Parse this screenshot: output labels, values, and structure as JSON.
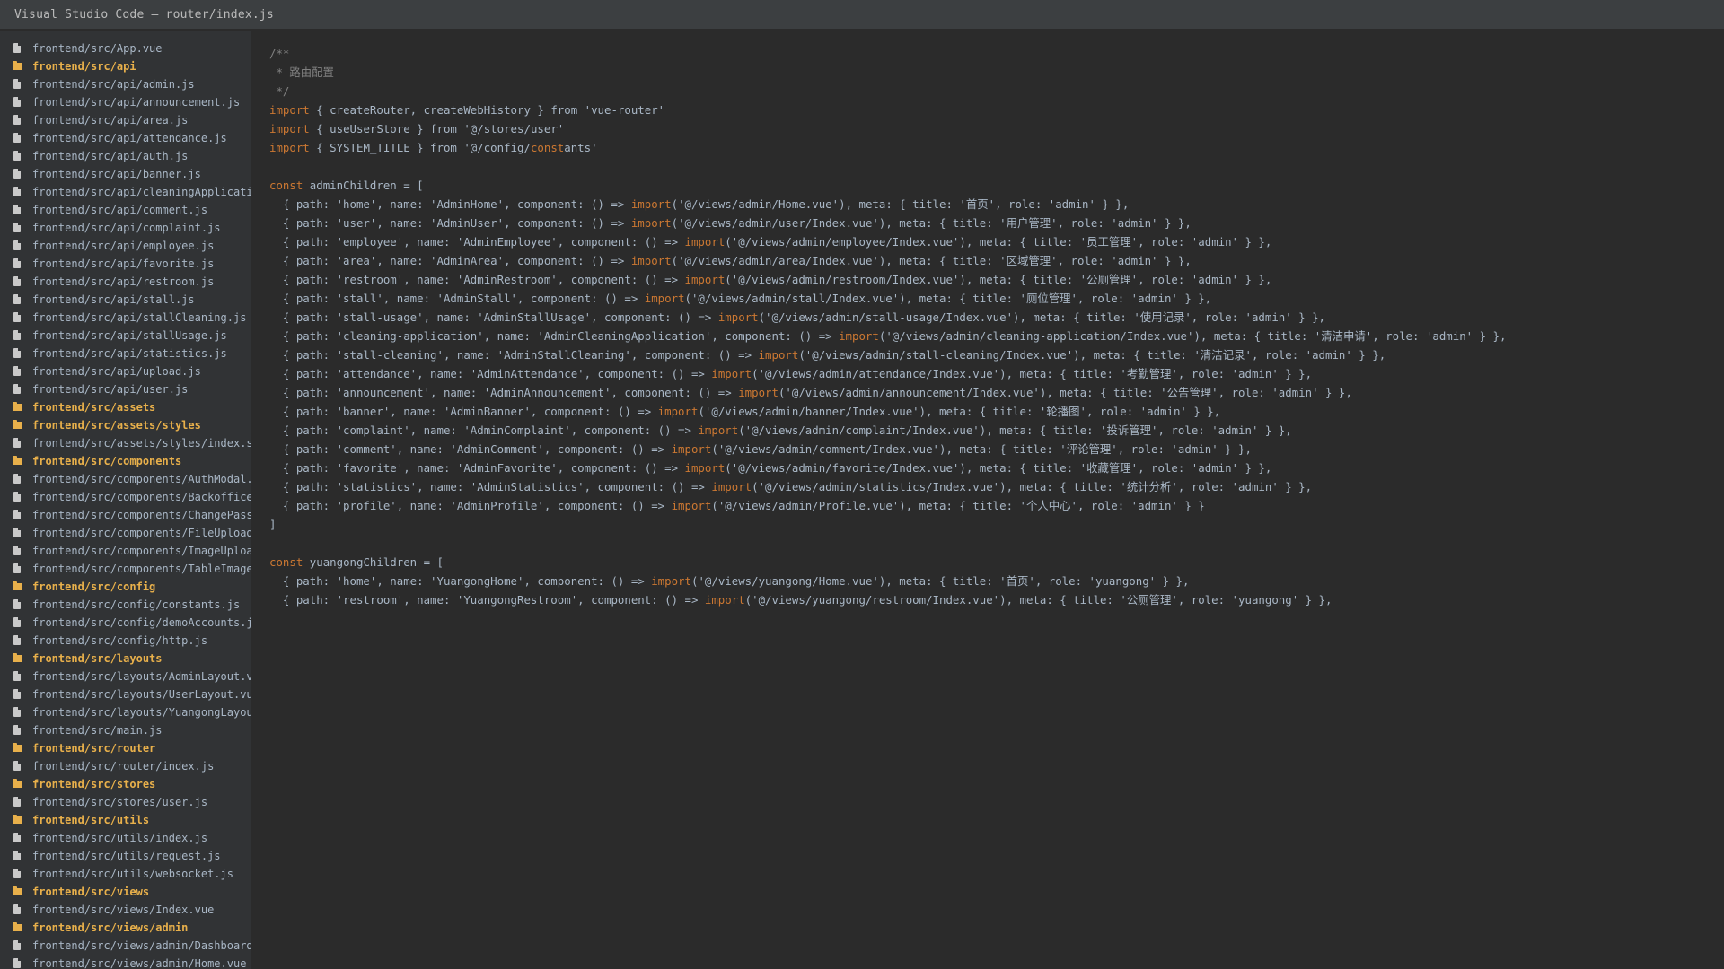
{
  "window": {
    "title": "Visual Studio Code — router/index.js"
  },
  "explorer": {
    "items": [
      {
        "type": "file",
        "label": "frontend/src/App.vue"
      },
      {
        "type": "folder",
        "label": "frontend/src/api"
      },
      {
        "type": "file",
        "label": "frontend/src/api/admin.js"
      },
      {
        "type": "file",
        "label": "frontend/src/api/announcement.js"
      },
      {
        "type": "file",
        "label": "frontend/src/api/area.js"
      },
      {
        "type": "file",
        "label": "frontend/src/api/attendance.js"
      },
      {
        "type": "file",
        "label": "frontend/src/api/auth.js"
      },
      {
        "type": "file",
        "label": "frontend/src/api/banner.js"
      },
      {
        "type": "file",
        "label": "frontend/src/api/cleaningApplicati"
      },
      {
        "type": "file",
        "label": "frontend/src/api/comment.js"
      },
      {
        "type": "file",
        "label": "frontend/src/api/complaint.js"
      },
      {
        "type": "file",
        "label": "frontend/src/api/employee.js"
      },
      {
        "type": "file",
        "label": "frontend/src/api/favorite.js"
      },
      {
        "type": "file",
        "label": "frontend/src/api/restroom.js"
      },
      {
        "type": "file",
        "label": "frontend/src/api/stall.js"
      },
      {
        "type": "file",
        "label": "frontend/src/api/stallCleaning.js"
      },
      {
        "type": "file",
        "label": "frontend/src/api/stallUsage.js"
      },
      {
        "type": "file",
        "label": "frontend/src/api/statistics.js"
      },
      {
        "type": "file",
        "label": "frontend/src/api/upload.js"
      },
      {
        "type": "file",
        "label": "frontend/src/api/user.js"
      },
      {
        "type": "folder",
        "label": "frontend/src/assets"
      },
      {
        "type": "folder",
        "label": "frontend/src/assets/styles"
      },
      {
        "type": "file",
        "label": "frontend/src/assets/styles/index.s"
      },
      {
        "type": "folder",
        "label": "frontend/src/components"
      },
      {
        "type": "file",
        "label": "frontend/src/components/AuthModal."
      },
      {
        "type": "file",
        "label": "frontend/src/components/Backoffice"
      },
      {
        "type": "file",
        "label": "frontend/src/components/ChangePass"
      },
      {
        "type": "file",
        "label": "frontend/src/components/FileUpload"
      },
      {
        "type": "file",
        "label": "frontend/src/components/ImageUploa"
      },
      {
        "type": "file",
        "label": "frontend/src/components/TableImage"
      },
      {
        "type": "folder",
        "label": "frontend/src/config"
      },
      {
        "type": "file",
        "label": "frontend/src/config/constants.js"
      },
      {
        "type": "file",
        "label": "frontend/src/config/demoAccounts.j"
      },
      {
        "type": "file",
        "label": "frontend/src/config/http.js"
      },
      {
        "type": "folder",
        "label": "frontend/src/layouts"
      },
      {
        "type": "file",
        "label": "frontend/src/layouts/AdminLayout.v"
      },
      {
        "type": "file",
        "label": "frontend/src/layouts/UserLayout.vu"
      },
      {
        "type": "file",
        "label": "frontend/src/layouts/YuangongLayou"
      },
      {
        "type": "file",
        "label": "frontend/src/main.js"
      },
      {
        "type": "folder",
        "label": "frontend/src/router"
      },
      {
        "type": "file",
        "label": "frontend/src/router/index.js"
      },
      {
        "type": "folder",
        "label": "frontend/src/stores"
      },
      {
        "type": "file",
        "label": "frontend/src/stores/user.js"
      },
      {
        "type": "folder",
        "label": "frontend/src/utils"
      },
      {
        "type": "file",
        "label": "frontend/src/utils/index.js"
      },
      {
        "type": "file",
        "label": "frontend/src/utils/request.js"
      },
      {
        "type": "file",
        "label": "frontend/src/utils/websocket.js"
      },
      {
        "type": "folder",
        "label": "frontend/src/views"
      },
      {
        "type": "file",
        "label": "frontend/src/views/Index.vue"
      },
      {
        "type": "folder",
        "label": "frontend/src/views/admin"
      },
      {
        "type": "file",
        "label": "frontend/src/views/admin/Dashboard"
      },
      {
        "type": "file",
        "label": "frontend/src/views/admin/Home.vue"
      }
    ]
  },
  "editor": {
    "lines": [
      [
        {
          "t": "c",
          "s": "/**"
        }
      ],
      [
        {
          "t": "c",
          "s": " * 路由配置"
        }
      ],
      [
        {
          "t": "c",
          "s": " */"
        }
      ],
      [
        {
          "t": "k",
          "s": "import"
        },
        {
          "t": "p",
          "s": " { createRouter, createWebHistory } from 'vue-router'"
        }
      ],
      [
        {
          "t": "k",
          "s": "import"
        },
        {
          "t": "p",
          "s": " { useUserStore } from '@/stores/user'"
        }
      ],
      [
        {
          "t": "k",
          "s": "import"
        },
        {
          "t": "p",
          "s": " { SYSTEM_TITLE } from '@/config/"
        },
        {
          "t": "k",
          "s": "const"
        },
        {
          "t": "p",
          "s": "ants'"
        }
      ],
      [
        {
          "t": "p",
          "s": ""
        }
      ],
      [
        {
          "t": "k",
          "s": "const"
        },
        {
          "t": "p",
          "s": " adminChildren = ["
        }
      ],
      [
        {
          "t": "p",
          "s": "  { path: 'home', name: 'AdminHome', component: () => "
        },
        {
          "t": "k",
          "s": "import"
        },
        {
          "t": "p",
          "s": "('@/views/admin/Home.vue'), meta: { title: '首页', role: 'admin' } },"
        }
      ],
      [
        {
          "t": "p",
          "s": "  { path: 'user', name: 'AdminUser', component: () => "
        },
        {
          "t": "k",
          "s": "import"
        },
        {
          "t": "p",
          "s": "('@/views/admin/user/Index.vue'), meta: { title: '用户管理', role: 'admin' } },"
        }
      ],
      [
        {
          "t": "p",
          "s": "  { path: 'employee', name: 'AdminEmployee', component: () => "
        },
        {
          "t": "k",
          "s": "import"
        },
        {
          "t": "p",
          "s": "('@/views/admin/employee/Index.vue'), meta: { title: '员工管理', role: 'admin' } },"
        }
      ],
      [
        {
          "t": "p",
          "s": "  { path: 'area', name: 'AdminArea', component: () => "
        },
        {
          "t": "k",
          "s": "import"
        },
        {
          "t": "p",
          "s": "('@/views/admin/area/Index.vue'), meta: { title: '区域管理', role: 'admin' } },"
        }
      ],
      [
        {
          "t": "p",
          "s": "  { path: 'restroom', name: 'AdminRestroom', component: () => "
        },
        {
          "t": "k",
          "s": "import"
        },
        {
          "t": "p",
          "s": "('@/views/admin/restroom/Index.vue'), meta: { title: '公厕管理', role: 'admin' } },"
        }
      ],
      [
        {
          "t": "p",
          "s": "  { path: 'stall', name: 'AdminStall', component: () => "
        },
        {
          "t": "k",
          "s": "import"
        },
        {
          "t": "p",
          "s": "('@/views/admin/stall/Index.vue'), meta: { title: '厕位管理', role: 'admin' } },"
        }
      ],
      [
        {
          "t": "p",
          "s": "  { path: 'stall-usage', name: 'AdminStallUsage', component: () => "
        },
        {
          "t": "k",
          "s": "import"
        },
        {
          "t": "p",
          "s": "('@/views/admin/stall-usage/Index.vue'), meta: { title: '使用记录', role: 'admin' } },"
        }
      ],
      [
        {
          "t": "p",
          "s": "  { path: 'cleaning-application', name: 'AdminCleaningApplication', component: () => "
        },
        {
          "t": "k",
          "s": "import"
        },
        {
          "t": "p",
          "s": "('@/views/admin/cleaning-application/Index.vue'), meta: { title: '清洁申请', role: 'admin' } },"
        }
      ],
      [
        {
          "t": "p",
          "s": "  { path: 'stall-cleaning', name: 'AdminStallCleaning', component: () => "
        },
        {
          "t": "k",
          "s": "import"
        },
        {
          "t": "p",
          "s": "('@/views/admin/stall-cleaning/Index.vue'), meta: { title: '清洁记录', role: 'admin' } },"
        }
      ],
      [
        {
          "t": "p",
          "s": "  { path: 'attendance', name: 'AdminAttendance', component: () => "
        },
        {
          "t": "k",
          "s": "import"
        },
        {
          "t": "p",
          "s": "('@/views/admin/attendance/Index.vue'), meta: { title: '考勤管理', role: 'admin' } },"
        }
      ],
      [
        {
          "t": "p",
          "s": "  { path: 'announcement', name: 'AdminAnnouncement', component: () => "
        },
        {
          "t": "k",
          "s": "import"
        },
        {
          "t": "p",
          "s": "('@/views/admin/announcement/Index.vue'), meta: { title: '公告管理', role: 'admin' } },"
        }
      ],
      [
        {
          "t": "p",
          "s": "  { path: 'banner', name: 'AdminBanner', component: () => "
        },
        {
          "t": "k",
          "s": "import"
        },
        {
          "t": "p",
          "s": "('@/views/admin/banner/Index.vue'), meta: { title: '轮播图', role: 'admin' } },"
        }
      ],
      [
        {
          "t": "p",
          "s": "  { path: 'complaint', name: 'AdminComplaint', component: () => "
        },
        {
          "t": "k",
          "s": "import"
        },
        {
          "t": "p",
          "s": "('@/views/admin/complaint/Index.vue'), meta: { title: '投诉管理', role: 'admin' } },"
        }
      ],
      [
        {
          "t": "p",
          "s": "  { path: 'comment', name: 'AdminComment', component: () => "
        },
        {
          "t": "k",
          "s": "import"
        },
        {
          "t": "p",
          "s": "('@/views/admin/comment/Index.vue'), meta: { title: '评论管理', role: 'admin' } },"
        }
      ],
      [
        {
          "t": "p",
          "s": "  { path: 'favorite', name: 'AdminFavorite', component: () => "
        },
        {
          "t": "k",
          "s": "import"
        },
        {
          "t": "p",
          "s": "('@/views/admin/favorite/Index.vue'), meta: { title: '收藏管理', role: 'admin' } },"
        }
      ],
      [
        {
          "t": "p",
          "s": "  { path: 'statistics', name: 'AdminStatistics', component: () => "
        },
        {
          "t": "k",
          "s": "import"
        },
        {
          "t": "p",
          "s": "('@/views/admin/statistics/Index.vue'), meta: { title: '统计分析', role: 'admin' } },"
        }
      ],
      [
        {
          "t": "p",
          "s": "  { path: 'profile', name: 'AdminProfile', component: () => "
        },
        {
          "t": "k",
          "s": "import"
        },
        {
          "t": "p",
          "s": "('@/views/admin/Profile.vue'), meta: { title: '个人中心', role: 'admin' } }"
        }
      ],
      [
        {
          "t": "p",
          "s": "]"
        }
      ],
      [
        {
          "t": "p",
          "s": ""
        }
      ],
      [
        {
          "t": "k",
          "s": "const"
        },
        {
          "t": "p",
          "s": " yuangongChildren = ["
        }
      ],
      [
        {
          "t": "p",
          "s": "  { path: 'home', name: 'YuangongHome', component: () => "
        },
        {
          "t": "k",
          "s": "import"
        },
        {
          "t": "p",
          "s": "('@/views/yuangong/Home.vue'), meta: { title: '首页', role: 'yuangong' } },"
        }
      ],
      [
        {
          "t": "p",
          "s": "  { path: 'restroom', name: 'YuangongRestroom', component: () => "
        },
        {
          "t": "k",
          "s": "import"
        },
        {
          "t": "p",
          "s": "('@/views/yuangong/restroom/Index.vue'), meta: { title: '公厕管理', role: 'yuangong' } },"
        }
      ]
    ]
  },
  "colors": {
    "keyword": "#cc7832",
    "comment": "#808080",
    "text": "#a9b7c6",
    "folder": "#e8b04b",
    "background": "#2b2b2b"
  }
}
